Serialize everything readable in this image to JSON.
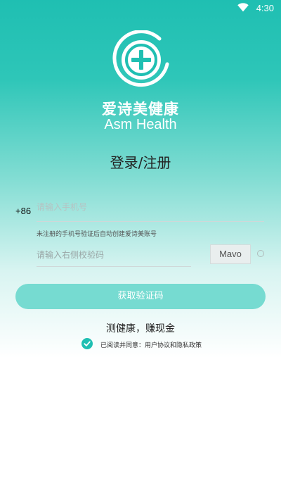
{
  "status_bar": {
    "time": "4:30",
    "wifi_icon": "wifi-icon"
  },
  "brand": {
    "logo_icon": "plus-logo-icon",
    "name_cn": "爱诗美健康",
    "name_en": "Asm Health",
    "accent_color": "#1fbfb2"
  },
  "page": {
    "title": "登录/注册"
  },
  "phone": {
    "country_code": "+86",
    "placeholder": "请输入手机号",
    "value": ""
  },
  "hint": "未注册的手机号验证后自动创建爱诗美账号",
  "captcha": {
    "placeholder": "请输入右侧校验码",
    "value": "",
    "image_text": "Mavo",
    "refresh_icon": "refresh-icon"
  },
  "get_code_button": {
    "label": "获取验证码"
  },
  "slogan": "测健康，赚现金",
  "agreement": {
    "checked": true,
    "text": "已阅读并同意：用户协议和隐私政策",
    "check_icon": "check-circle-icon"
  }
}
